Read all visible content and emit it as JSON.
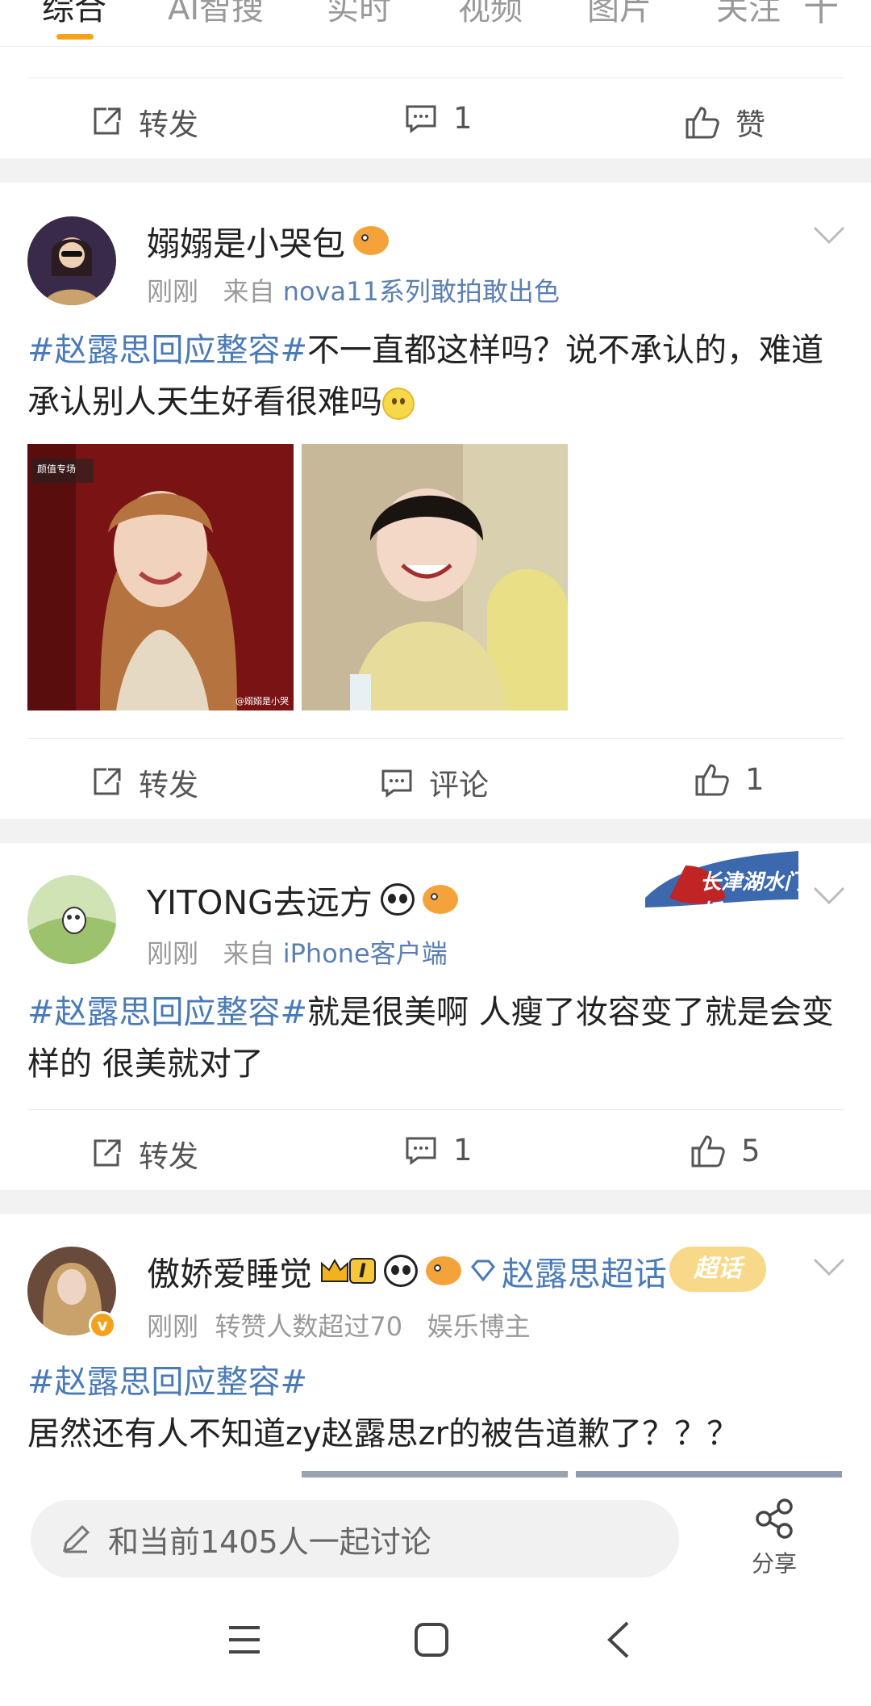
{
  "tabs": {
    "items": [
      "综合",
      "AI智搜",
      "实时",
      "视频",
      "图片",
      "关注"
    ],
    "active": "综合",
    "more": "十"
  },
  "top_action_bar": {
    "repost": "转发",
    "comment": "1",
    "like": "赞"
  },
  "posts": [
    {
      "username": "嫋嫋是小哭包",
      "time": "刚刚",
      "source_prefix": "来自",
      "source": "nova11系列敢拍敢出色",
      "hashtag": "#赵露思回应整容#",
      "text": "不一直都这样吗？说不承认的，难道承认别人天生好看很难吗",
      "image_watermark": "@嫋嫋是小哭",
      "image_badge": "颜值专场",
      "actions": {
        "repost": "转发",
        "comment": "评论",
        "like": "1"
      }
    },
    {
      "username": "YITONG去远方",
      "time": "刚刚",
      "source_prefix": "来自",
      "source": "iPhone客户端",
      "hashtag": "#赵露思回应整容#",
      "text": "就是很美啊 人瘦了妆容变了就是会变样的 很美就对了",
      "banner": "长津湖水门桥",
      "actions": {
        "repost": "转发",
        "comment": "1",
        "like": "5"
      }
    },
    {
      "username": "傲娇爱睡觉",
      "level_badge": "I",
      "super_topic": "赵露思超话",
      "super_topic_badge": "超话",
      "time": "刚刚",
      "meta_1": "转赞人数超过70",
      "meta_2": "娱乐博主",
      "hashtag": "#赵露思回应整容#",
      "text": "居然还有人不知道zy赵露思zr的被告道歉了？？？"
    }
  ],
  "bottom": {
    "input_placeholder": "和当前1405人一起讨论",
    "share": "分享"
  },
  "colors": {
    "accent": "#f7a21b",
    "link": "#4a7bb7",
    "divider": "#f2f2f2"
  }
}
